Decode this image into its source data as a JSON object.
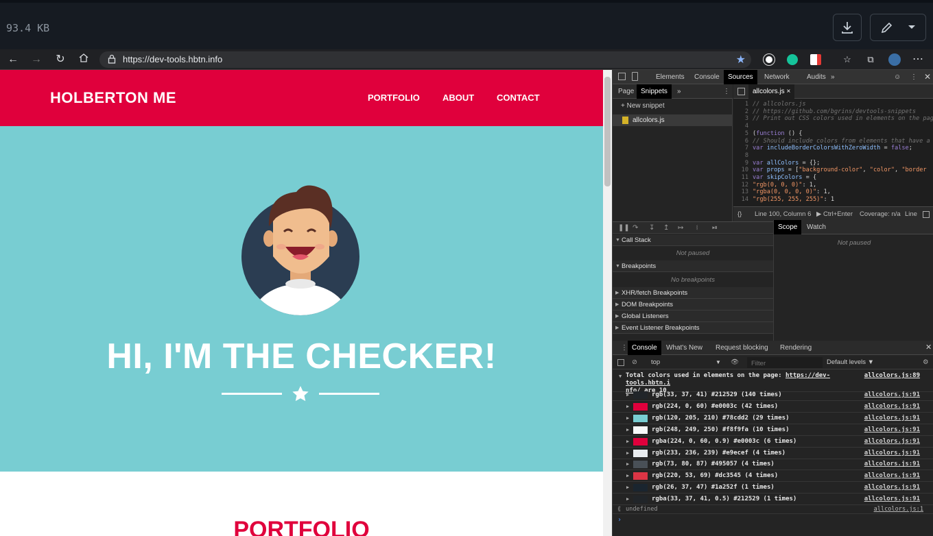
{
  "filebar": {
    "size": "93.4 KB"
  },
  "browser": {
    "url": "https://dev-tools.hbtn.info"
  },
  "site": {
    "brand": "HOLBERTON ME",
    "nav": [
      "PORTFOLIO",
      "ABOUT",
      "CONTACT"
    ],
    "hero_title": "HI, I'M THE CHECKER!",
    "section_title": "PORTFOLIO",
    "colors": {
      "red": "#e0003c",
      "teal": "#78cdd2",
      "navy": "#212529"
    }
  },
  "devtools": {
    "tabs": [
      "Elements",
      "Console",
      "Sources",
      "Network",
      "Audits"
    ],
    "active_tab": "Sources",
    "nav_tabs": [
      "Page",
      "Snippets"
    ],
    "new_snippet": "+ New snippet",
    "snippet_file": "allcolors.js",
    "editor_tab": "allcolors.js",
    "code": [
      {
        "n": "1",
        "html": "<span class='cmt'>// allcolors.js</span>"
      },
      {
        "n": "2",
        "html": "<span class='cmt'>// https://github.com/bgrins/devtools-snippets</span>"
      },
      {
        "n": "3",
        "html": "<span class='cmt'>// Print out CSS colors used in elements on the page.</span>"
      },
      {
        "n": "4",
        "html": ""
      },
      {
        "n": "5",
        "html": "(<span class='kw'>function</span> () {"
      },
      {
        "n": "6",
        "html": "  <span class='cmt'>// Should include colors from elements that have a border color but</span>"
      },
      {
        "n": "7",
        "html": "  <span class='kw'>var</span> <span class='var'>includeBorderColorsWithZeroWidth</span> = <span class='kw'>false</span>;"
      },
      {
        "n": "8",
        "html": ""
      },
      {
        "n": "9",
        "html": "  <span class='kw'>var</span> <span class='var'>allColors</span> = {};"
      },
      {
        "n": "10",
        "html": "  <span class='kw'>var</span> <span class='var'>props</span> = [<span class='str'>\"background-color\"</span>, <span class='str'>\"color\"</span>, <span class='str'>\"border</span>"
      },
      {
        "n": "11",
        "html": "  <span class='kw'>var</span> <span class='var'>skipColors</span> = {"
      },
      {
        "n": "12",
        "html": "    <span class='str'>\"rgb(0, 0, 0)\"</span>: 1,"
      },
      {
        "n": "13",
        "html": "    <span class='str'>\"rgba(0, 0, 0, 0)\"</span>: 1,"
      },
      {
        "n": "14",
        "html": "    <span class='str'>\"rgb(255, 255, 255)\"</span>: 1"
      }
    ],
    "status": {
      "position": "Line 100, Column 6",
      "run": "Ctrl+Enter",
      "coverage": "Coverage: n/a",
      "line": "Line"
    },
    "debugger": {
      "sections": [
        "Call Stack",
        "Breakpoints",
        "XHR/fetch Breakpoints",
        "DOM Breakpoints",
        "Global Listeners",
        "Event Listener Breakpoints"
      ],
      "not_paused": "Not paused",
      "no_breakpoints": "No breakpoints",
      "scope_tabs": [
        "Scope",
        "Watch"
      ],
      "scope_not_paused": "Not paused"
    },
    "drawer_tabs": [
      "Console",
      "What's New",
      "Request blocking",
      "Rendering"
    ],
    "console_toolbar": {
      "context": "top",
      "filter_placeholder": "Filter",
      "levels": "Default levels ▼"
    },
    "console": {
      "header_1": "Total colors used in elements on the page: ",
      "header_link": "https://dev-tools.hbtn.i",
      "header_2": "nfo/",
      "header_3": " are 10",
      "header_src": "allcolors.js:89",
      "rows": [
        {
          "text": "rgb(33, 37, 41) #212529 (140 times)",
          "color": "#212529",
          "src": "allcolors.js:91"
        },
        {
          "text": "rgb(224, 0, 60) #e0003c (42 times)",
          "color": "#e0003c",
          "src": "allcolors.js:91"
        },
        {
          "text": "rgb(120, 205, 210) #78cdd2 (29 times)",
          "color": "#78cdd2",
          "src": "allcolors.js:91"
        },
        {
          "text": "rgb(248, 249, 250) #f8f9fa (10 times)",
          "color": "#f8f9fa",
          "src": "allcolors.js:91"
        },
        {
          "text": "rgba(224, 0, 60, 0.9) #e0003c (6 times)",
          "color": "#e0003c",
          "src": "allcolors.js:91"
        },
        {
          "text": "rgb(233, 236, 239) #e9ecef (4 times)",
          "color": "#e9ecef",
          "src": "allcolors.js:91"
        },
        {
          "text": "rgb(73, 80, 87) #495057 (4 times)",
          "color": "#495057",
          "src": "allcolors.js:91"
        },
        {
          "text": "rgb(220, 53, 69) #dc3545 (4 times)",
          "color": "#dc3545",
          "src": "allcolors.js:91"
        },
        {
          "text": "rgb(26, 37, 47) #1a252f (1 times)",
          "color": "#1a252f",
          "src": "allcolors.js:91"
        },
        {
          "text": "rgba(33, 37, 41, 0.5) #212529 (1 times)",
          "color": "#212529",
          "src": "allcolors.js:91"
        }
      ],
      "result": "undefined",
      "result_src": "allcolors.js:1"
    }
  }
}
